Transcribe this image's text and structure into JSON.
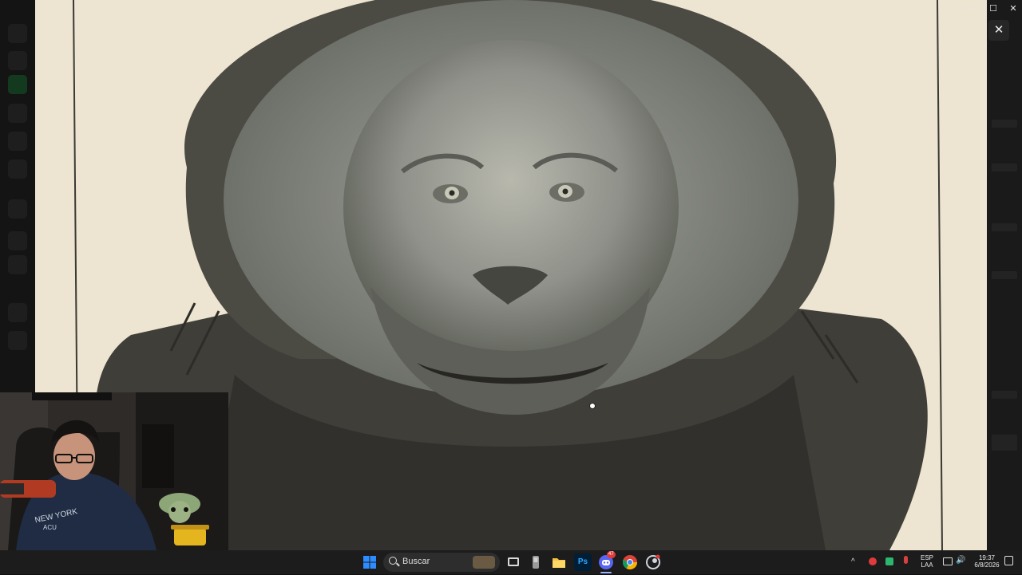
{
  "viewer": {
    "close_glyph": "✕",
    "minimize_glyph": "—",
    "maximize_glyph": "☐"
  },
  "photo": {
    "subject": "orangutan-portrait"
  },
  "webcam": {
    "sweatshirt_text": "NEW YORK",
    "sweatshirt_subtext": "ACU"
  },
  "taskbar": {
    "search_placeholder": "Buscar",
    "pinned": [
      "start-icon",
      "task-view-icon",
      "app-icon",
      "file-explorer-icon",
      "photoshop-icon",
      "discord-icon",
      "chrome-icon",
      "steam-icon"
    ],
    "photoshop_label": "Ps",
    "discord_badge": "47",
    "tray": {
      "language": "ESP",
      "layout": "LAA",
      "time": "19:37",
      "date": "6/8/2026"
    }
  },
  "colors": {
    "taskbar_bg": "#1c1c1c",
    "accent_blue": "#2d8cff",
    "paper": "#ede4d1"
  }
}
